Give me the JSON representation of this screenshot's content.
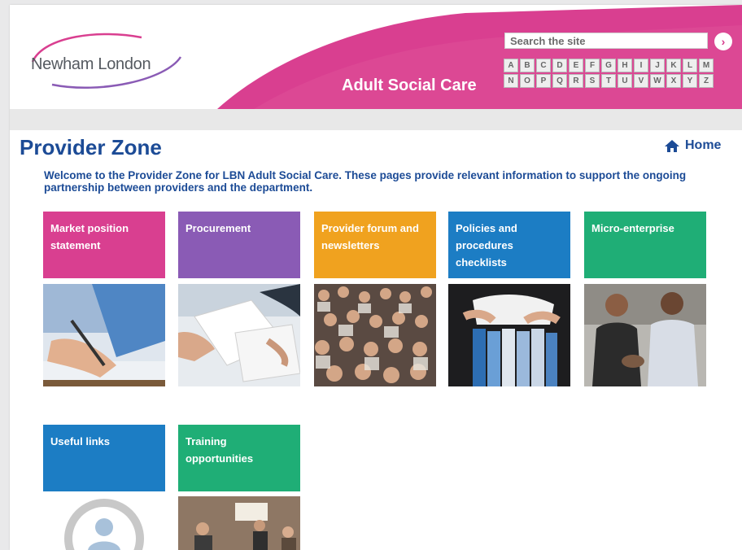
{
  "header": {
    "logo_text": "Newham London",
    "section_title": "Adult Social Care",
    "search": {
      "placeholder": "Search the site",
      "go_label": "›"
    },
    "az_rows": [
      [
        "A",
        "B",
        "C",
        "D",
        "E",
        "F",
        "G",
        "H",
        "I",
        "J",
        "K",
        "L",
        "M"
      ],
      [
        "N",
        "O",
        "P",
        "Q",
        "R",
        "S",
        "T",
        "U",
        "V",
        "W",
        "X",
        "Y",
        "Z"
      ]
    ]
  },
  "page": {
    "title": "Provider Zone",
    "home_label": "Home",
    "intro": "Welcome to the Provider Zone for LBN Adult Social Care. These pages provide relevant information to support the ongoing partnership between providers and the department."
  },
  "tiles": [
    {
      "label": "Market position statement",
      "color": "#d93f90"
    },
    {
      "label": "Procurement",
      "color": "#8a5bb5"
    },
    {
      "label": "Provider forum and newsletters",
      "color": "#f0a21f"
    },
    {
      "label": "Policies and procedures checklists",
      "color": "#1c7dc4"
    },
    {
      "label": "Micro-enterprise",
      "color": "#1fae76"
    },
    {
      "label": "Useful links",
      "color": "#1c7dc4"
    },
    {
      "label": "Training opportunities",
      "color": "#1fae76"
    }
  ],
  "colors": {
    "brand_pink": "#d93f90",
    "title_blue": "#1c4b96"
  }
}
